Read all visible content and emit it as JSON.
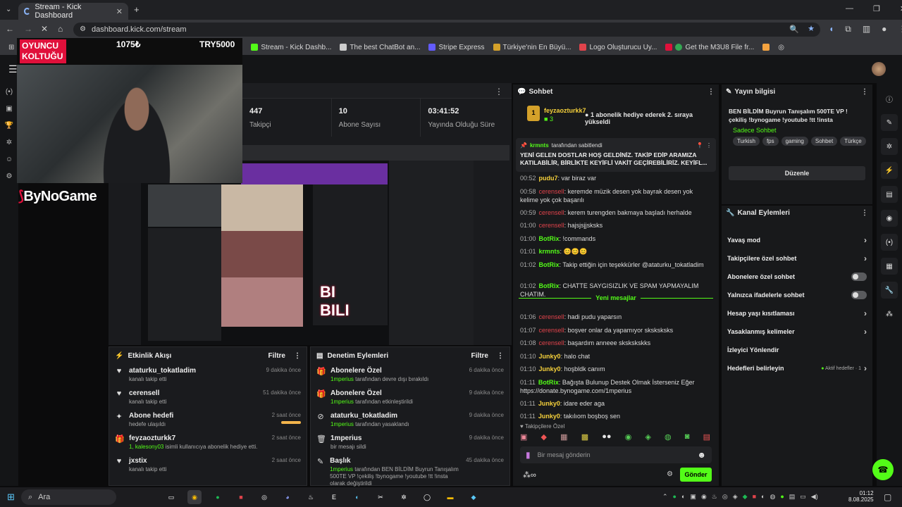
{
  "browser": {
    "tab_title": "Stream - Kick Dashboard",
    "url": "dashboard.kick.com/stream",
    "bookmarks": [
      "Stream - Kick Dashb...",
      "The best ChatBot an...",
      "Stripe Express",
      "Türkiye'nin En Büyü...",
      "Logo Oluşturucu Uy...",
      "Get the M3U8 File fr..."
    ]
  },
  "overlay": {
    "badge_line1": "OYUNCU",
    "badge_line2": "KOLTUĞU",
    "ticker_value": "1075₺",
    "ticker_try": "TRY5000",
    "brand": "ByNoGame"
  },
  "stats": [
    {
      "value": "447",
      "label": "Takipçi"
    },
    {
      "value": "10",
      "label": "Abone Sayısı"
    },
    {
      "value": "03:41:52",
      "label": "Yayında Olduğu Süre"
    }
  ],
  "activity": {
    "title": "Etkinlik Akışı",
    "filter": "Filtre",
    "items": [
      {
        "name": "ataturku_tokatladim",
        "desc": "kanalı takip etti",
        "time": "9 dakika önce",
        "icon": "heart-icon"
      },
      {
        "name": "cerensell",
        "desc": "kanalı takip etti",
        "time": "51 dakika önce",
        "icon": "heart-icon"
      },
      {
        "name": "Abone hedefi",
        "desc": "hedefe ulaşıldı",
        "time": "2 saat önce",
        "icon": "sparkle-icon"
      },
      {
        "name": "feyzaozturkk7",
        "desc_user": "1, kalesony03",
        "desc": "isimli kullanıcıya abonelik hediye etti.",
        "time": "2 saat önce",
        "icon": "gift-icon"
      },
      {
        "name": "jxstix",
        "desc": "kanalı takip etti",
        "time": "2 saat önce",
        "icon": "heart-icon"
      }
    ]
  },
  "moderation": {
    "title": "Denetim Eylemleri",
    "filter": "Filtre",
    "items": [
      {
        "name": "Abonelere Özel",
        "user": "1mperius",
        "desc": "tarafından devre dışı bırakıldı",
        "time": "6 dakika önce"
      },
      {
        "name": "Abonelere Özel",
        "user": "1mperius",
        "desc": "tarafından etkinleştirildi",
        "time": "9 dakika önce"
      },
      {
        "name": "ataturku_tokatladim",
        "user": "1mperius",
        "desc": "tarafından yasaklandı",
        "time": "9 dakika önce"
      },
      {
        "name": "1mperius",
        "user": "",
        "desc": "bir mesajı sildi",
        "time": "9 dakika önce"
      },
      {
        "name": "Başlık",
        "user": "1mperius",
        "desc": "tarafından BEN BİLDİM Buyrun Tanışalım 500TE VP !çekiliş !bynogame !youtube !tt !insta olarak değiştirildi",
        "time": "45 dakika önce"
      }
    ]
  },
  "chat": {
    "title": "Sohbet",
    "gift_user": "feyzaozturkk7",
    "gift_count": "3",
    "gift_text": "1 abonelik hediye ederek 2. sıraya yükseldi",
    "pinned_by": "krmnts",
    "pinned_label": "tarafından sabitlendi",
    "pinned_text": "YENİ GELEN DOSTLAR HOŞ GELDİNİZ. TAKİP EDİP ARAMIZA KATILABİLİR, BİRLİKTE KEYİFLİ VAKİT GEÇİREBİLİRİZ. KEYİFL...",
    "new_messages": "Yeni mesajlar",
    "messages": [
      {
        "time": "00:52",
        "user": "pudu7",
        "color": "yl",
        "text": "var biraz var"
      },
      {
        "time": "00:58",
        "user": "cerensell",
        "color": "red",
        "text": "keremde müzik desen yok bayrak desen yok kelime yok çok başarılı"
      },
      {
        "time": "00:59",
        "user": "cerensell",
        "color": "red",
        "text": "kerem turengden bakmaya başladı herhalde"
      },
      {
        "time": "01:00",
        "user": "cerensell",
        "color": "red",
        "text": "hajsjsjjsksks"
      },
      {
        "time": "01:00",
        "user": "BotRix",
        "color": "gn",
        "text": "!commands"
      },
      {
        "time": "01:01",
        "user": "krmnts",
        "color": "gn",
        "text": "😊😊😊"
      },
      {
        "time": "01:02",
        "user": "BotRix",
        "color": "gn",
        "text": "Takip ettiğin için teşekkürler @ataturku_tokatladim"
      },
      {
        "time": "01:02",
        "user": "BotRix",
        "color": "gn",
        "text": "CHATTE SAYGISIZLIK VE SPAM YAPMAYALIM CHATIM."
      },
      {
        "time": "01:06",
        "user": "cerensell",
        "color": "red",
        "text": "hadi pudu yaparsın"
      },
      {
        "time": "01:07",
        "user": "cerensell",
        "color": "red",
        "text": "boşver onlar da yapamıyor sksksksks"
      },
      {
        "time": "01:08",
        "user": "cerensell",
        "color": "red",
        "text": "başardım anneee skskskskks"
      },
      {
        "time": "01:10",
        "user": "Junky0",
        "color": "yl",
        "text": "halo chat"
      },
      {
        "time": "01:10",
        "user": "Junky0",
        "color": "yl",
        "text": "hoşbldk canım"
      },
      {
        "time": "01:11",
        "user": "BotRix",
        "color": "gn",
        "text": "Bağışta Bulunup Destek Olmak İsterseniz Eğer https://donate.bynogame.com/1mperius"
      },
      {
        "time": "01:11",
        "user": "Junky0",
        "color": "yl",
        "text": "idare eder aga"
      },
      {
        "time": "01:11",
        "user": "Junky0",
        "color": "yl",
        "text": "takılıom boşboş sen"
      }
    ],
    "emote_section": "Takipçilere Özel",
    "input_placeholder": "Bir mesaj gönderin",
    "send_label": "Gönder"
  },
  "stream_info": {
    "title": "Yayın bilgisi",
    "stream_title": "BEN BİLDİM Buyrun Tanışalım 500TE VP !çekiliş !bynogame !youtube !tt !insta",
    "category": "Sadece Sohbet",
    "tags": [
      "Turkish",
      "fps",
      "gaming",
      "Sohbet",
      "Türkçe"
    ],
    "edit_label": "Düzenle"
  },
  "channel_actions": {
    "title": "Kanal Eylemleri",
    "items": [
      {
        "label": "Yavaş mod",
        "type": "chevron"
      },
      {
        "label": "Takipçilere özel sohbet",
        "type": "chevron"
      },
      {
        "label": "Abonelere özel sohbet",
        "type": "toggle"
      },
      {
        "label": "Yalnızca ifadelerle sohbet",
        "type": "toggle"
      },
      {
        "label": "Hesap yaşı kısıtlaması",
        "type": "chevron"
      },
      {
        "label": "Yasaklanmış kelimeler",
        "type": "chevron"
      },
      {
        "label": "İzleyici Yönlendir",
        "type": "none"
      },
      {
        "label": "Hedefleri belirleyin",
        "type": "chevron"
      }
    ],
    "active_goals": "Aktif hedefler · 1"
  },
  "taskbar": {
    "search_label": "Ara",
    "time": "01:12",
    "date": "8.08.2025"
  },
  "colors": {
    "kick_green": "#53fc18",
    "badge_red": "#e0103b"
  }
}
